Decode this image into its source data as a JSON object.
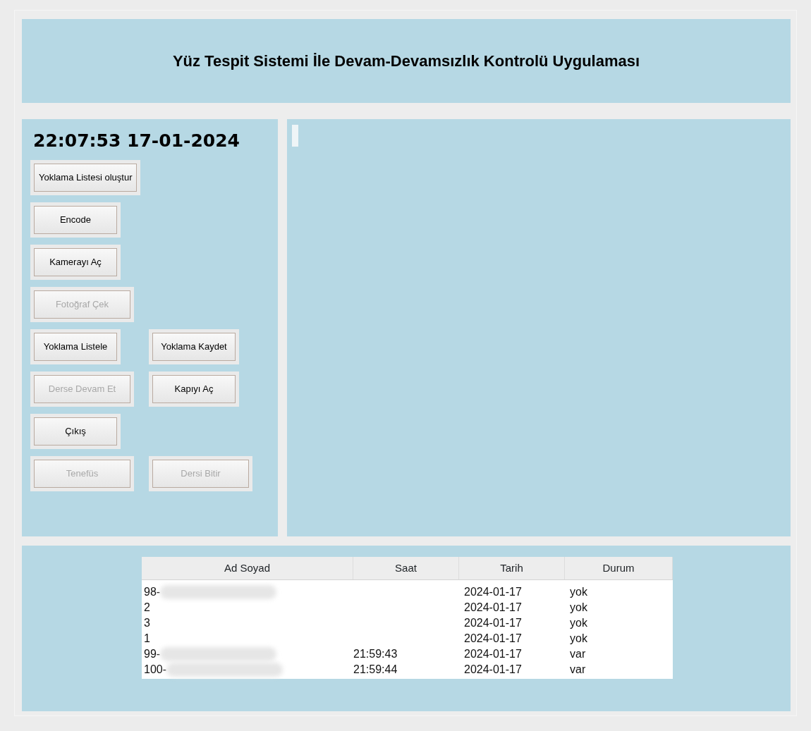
{
  "header": {
    "title": "Yüz Tespit Sistemi İle Devam-Devamsızlık Kontrolü Uygulaması"
  },
  "clock": {
    "time": "22:07:53",
    "date": "17-01-2024"
  },
  "button_rows": [
    [
      {
        "label": "Yoklama Listesi oluştur",
        "disabled": false
      }
    ],
    [
      {
        "label": "Encode",
        "disabled": false
      }
    ],
    [
      {
        "label": "Kamerayı Aç",
        "disabled": false
      }
    ],
    [
      {
        "label": "Fotoğraf Çek",
        "disabled": true
      }
    ],
    [
      {
        "label": "Yoklama Listele",
        "disabled": false
      },
      {
        "label": "Yoklama Kaydet",
        "disabled": false
      }
    ],
    [
      {
        "label": "Derse Devam Et",
        "disabled": true
      },
      {
        "label": "Kapıyı Aç",
        "disabled": false
      }
    ],
    [
      {
        "label": "Çıkış",
        "disabled": false
      }
    ],
    [
      {
        "label": "Tenefüs",
        "disabled": true
      },
      {
        "label": "Dersi Bitir",
        "disabled": true
      }
    ]
  ],
  "table": {
    "columns": [
      "Ad Soyad",
      "Saat",
      "Tarih",
      "Durum"
    ],
    "rows": [
      {
        "name": "98-",
        "redacted": true,
        "time": "",
        "date": "2024-01-17",
        "status": "yok"
      },
      {
        "name": "2",
        "redacted": false,
        "time": "",
        "date": "2024-01-17",
        "status": "yok"
      },
      {
        "name": "3",
        "redacted": false,
        "time": "",
        "date": "2024-01-17",
        "status": "yok"
      },
      {
        "name": "1",
        "redacted": false,
        "time": "",
        "date": "2024-01-17",
        "status": "yok"
      },
      {
        "name": "99-",
        "redacted": true,
        "time": "21:59:43",
        "date": "2024-01-17",
        "status": "var"
      },
      {
        "name": "100-",
        "redacted": true,
        "time": "21:59:44",
        "date": "2024-01-17",
        "status": "var"
      }
    ]
  }
}
